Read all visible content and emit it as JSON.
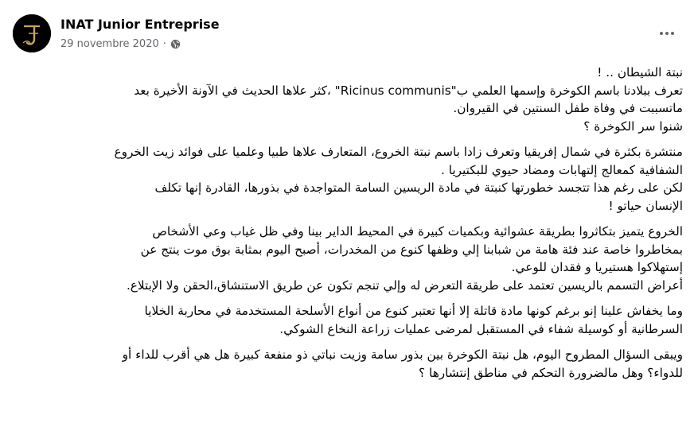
{
  "post": {
    "page_name": "INAT Junior Entreprise",
    "date": "29 novembre 2020",
    "separator": "·",
    "visibility_icon": "globe-icon",
    "more_icon": "more-options-icon",
    "avatar_icon": "inat-logo-j-icon",
    "avatar_colors": {
      "background": "#000000",
      "accent": "#c9a45c"
    },
    "paragraphs": [
      [
        "نبتة الشيطان .. !",
        "تعرف ببلادنا باسم الكوخرة وإسمها العلمي ب\"Ricinus communis\" ،كثر علاها الحديث في الآونة الأخيرة بعد",
        "ماتسببت في وفاة طفل السنتين في القيروان.",
        "شنوا سر الكوخرة ؟"
      ],
      [
        "منتشرة بكثرة في شمال إفريقيا وتعرف زادا باسم نبتة الخروع، المتعارف علاها طبيا وعلميا على فوائد زيت الخروع",
        "الشفافية كمعالج إلتهابات ومضاد حيوي للبكتيريا .",
        "لكن على رغم هذا تتجسد خطورتها كنبتة في مادة الريسين السامة المتواجدة في بذورها، القادرة إنها تكلف",
        "الإنسان حياتو !"
      ],
      [
        "الخروع يتميز بتكاثروا بطريقة عشوائية وبكميات كبيرة في المحيط الداير بينا وفي ظل غياب وعي الأشخاص",
        "بمخاطروا خاصة عند فئة هامة من شبابنا إلي وظفها كنوع من المخدرات، أصبح اليوم بمثابة بوق موت ينتج عن",
        "إستهلاكوا هستيريا و فقدان للوعي.",
        "أعراض التسمم بالريسين تعتمد على طريقة التعرض له وإلي تنجم تكون عن طريق الاستنشاق،الحقن ولا الإبتلاع."
      ],
      [
        "وما يخفاش علينا إنو برغم كونها مادة قاتلة إلا أنها تعتبر كنوع من أنواع الأسلحة المستخدمة في محاربة الخلايا",
        "السرطانية أو كوسيلة شفاء في المستقبل لمرضى عمليات زراعة النخاع الشوكي."
      ],
      [
        "ويبقى السؤال المطروح اليوم، هل نبتة الكوخرة بين بذور سامة وزيت نباتي ذو منفعة كبيرة هل هي أقرب للداء أو",
        "للدواء؟ وهل مالضرورة التحكم في مناطق إنتشارها ؟"
      ]
    ]
  }
}
